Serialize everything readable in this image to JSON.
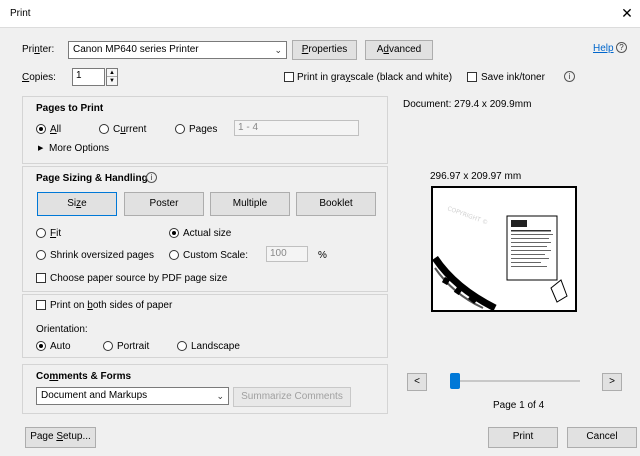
{
  "window": {
    "title": "Print",
    "close_glyph": "✕"
  },
  "printer": {
    "label_pre": "Pri",
    "label_u": "n",
    "label_post": "ter:",
    "selected": "Canon MP640 series Printer",
    "properties_u": "P",
    "properties_rest": "roperties",
    "advanced_pre": "A",
    "advanced_u": "d",
    "advanced_post": "vanced",
    "help_label": "Help",
    "help_icon": "?"
  },
  "copies": {
    "label_u": "C",
    "label_rest": "opies:",
    "value": "1",
    "grayscale_pre": "Print in gra",
    "grayscale_u": "y",
    "grayscale_post": "scale (black and white)",
    "save_ink": "Save ink/toner",
    "info_icon": "i"
  },
  "pages_to_print": {
    "heading": "Pages to Print",
    "all_u": "A",
    "all_rest": "ll",
    "current_pre": "C",
    "current_u": "u",
    "current_post": "rrent",
    "pages_label": "Pages",
    "pages_value": "1 - 4",
    "more_options": "More Options",
    "more_arrow": "▶"
  },
  "sizing": {
    "heading": "Page Sizing & Handling",
    "info_icon": "i",
    "size_pre": "Si",
    "size_u": "z",
    "size_post": "e",
    "poster": "Poster",
    "multiple": "Multiple",
    "booklet": "Booklet",
    "fit_u": "F",
    "fit_rest": "it",
    "actual_size": "Actual size",
    "shrink": "Shrink oversized pages",
    "custom_scale": "Custom Scale:",
    "scale_value": "100",
    "percent": "%",
    "choose_source": "Choose paper source by PDF page size"
  },
  "both_sides": {
    "label_pre": "Print on ",
    "label_u": "b",
    "label_post": "oth sides of paper",
    "orientation": "Orientation:",
    "auto": "Auto",
    "portrait": "Portrait",
    "landscape": "Landscape"
  },
  "comments": {
    "heading_pre": "Co",
    "heading_u": "m",
    "heading_post": "ments & Forms",
    "selected": "Document and Markups",
    "summarize": "Summarize Comments"
  },
  "preview": {
    "document_size": "Document: 279.4 x 209.9mm",
    "sheet_size": "296.97 x 209.97 mm",
    "page_indicator": "Page 1 of 4",
    "prev": "<",
    "next": ">",
    "current_page_fraction": 0.0
  },
  "footer": {
    "page_setup_pre": "Page ",
    "page_setup_u": "S",
    "page_setup_post": "etup...",
    "print": "Print",
    "cancel": "Cancel"
  }
}
